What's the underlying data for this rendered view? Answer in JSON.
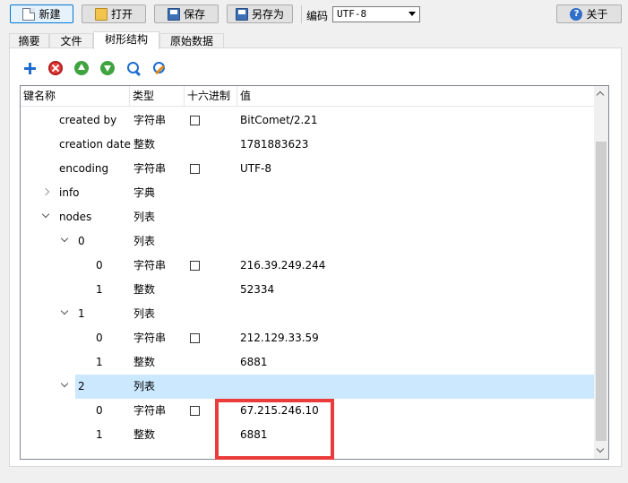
{
  "toolbar": {
    "new_label": "新建",
    "open_label": "打开",
    "save_label": "保存",
    "saveas_label": "另存为",
    "encoding_label": "编码",
    "encoding_value": "UTF-8",
    "about_label": "关于"
  },
  "tabs": [
    {
      "label": "摘要"
    },
    {
      "label": "文件"
    },
    {
      "label": "树形结构"
    },
    {
      "label": "原始数据"
    }
  ],
  "tree": {
    "columns": [
      "键名称",
      "类型",
      "十六进制",
      "值"
    ],
    "rows": [
      {
        "key": "created by",
        "type": "字符串",
        "value": "BitComet/2.21"
      },
      {
        "key": "creation date",
        "type": "整数",
        "value": "1781883623"
      },
      {
        "key": "encoding",
        "type": "字符串",
        "value": "UTF-8"
      },
      {
        "key": "info",
        "type": "字典",
        "value": ""
      },
      {
        "key": "nodes",
        "type": "列表",
        "value": ""
      },
      {
        "key": "0",
        "type": "列表",
        "value": ""
      },
      {
        "key": "0",
        "type": "字符串",
        "value": "216.39.249.244"
      },
      {
        "key": "1",
        "type": "整数",
        "value": "52334"
      },
      {
        "key": "1",
        "type": "列表",
        "value": ""
      },
      {
        "key": "0",
        "type": "字符串",
        "value": "212.129.33.59"
      },
      {
        "key": "1",
        "type": "整数",
        "value": "6881"
      },
      {
        "key": "2",
        "type": "列表",
        "value": ""
      },
      {
        "key": "0",
        "type": "字符串",
        "value": "67.215.246.10"
      },
      {
        "key": "1",
        "type": "整数",
        "value": "6881"
      }
    ]
  },
  "colors": {
    "selection": "#cce8ff",
    "highlight_box": "#ec3b3b"
  }
}
